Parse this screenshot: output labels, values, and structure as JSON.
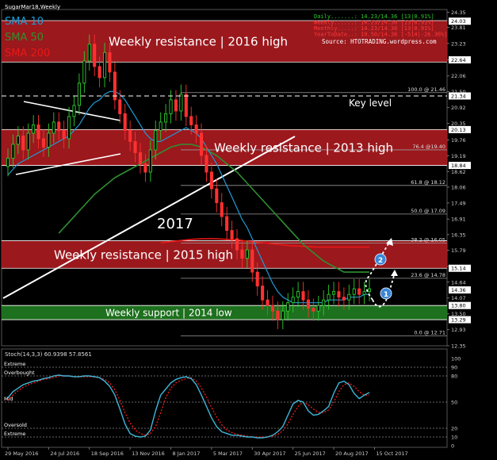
{
  "window": {
    "title": "SugarMar18,Weekly"
  },
  "indicators_legend": [
    {
      "label": "SMA 10",
      "color": "#1e9bd7"
    },
    {
      "label": "SMA 50",
      "color": "#2f8f2f"
    },
    {
      "label": "SMA 200",
      "color": "#e81818"
    }
  ],
  "info_panel": {
    "lines": [
      "Daily.......: 14.23/14.36 [13|0.91%]",
      "Weekly......: 14.23/14.36 [13|0.91%]",
      "Monthly.....: 14.23/14.36 [13|0.91%]",
      "YearToDate..: 19.50/14.36 [-514|-26.36%]"
    ],
    "source": "Source:  HTOTRADING.wordpress.com"
  },
  "zones": [
    {
      "label": "Weekly resistance | 2016 high",
      "lo": 22.56,
      "hi": 24.05,
      "color": "#a81a1f"
    },
    {
      "label": "Weekly resistance | 2013 high",
      "lo": 18.84,
      "hi": 20.13,
      "color": "#a81a1f"
    },
    {
      "label": "Weekly resistance | 2015 high",
      "lo": 15.14,
      "hi": 16.13,
      "color": "#a81a1f"
    },
    {
      "label": "Weekly support | 2014 low",
      "lo": 13.29,
      "hi": 13.8,
      "color": "#1f7a1f"
    }
  ],
  "annotations": {
    "key_level": "Key level",
    "year": "2017",
    "markers": [
      "1",
      "2"
    ]
  },
  "chart_data": {
    "type": "candlestick",
    "price_axis": {
      "ylim": [
        12.35,
        24.45
      ],
      "ticks": [
        "24.35",
        "23.81",
        "23.23",
        "22.64",
        "22.06",
        "21.50",
        "20.92",
        "20.35",
        "19.76",
        "19.19",
        "18.62",
        "18.06",
        "17.49",
        "16.91",
        "16.35",
        "15.79",
        "15.21",
        "14.64",
        "14.07",
        "13.50",
        "12.93",
        "12.35"
      ],
      "highlighted": [
        {
          "label": "24.03",
          "value": 24.03,
          "bg": "#ffffff",
          "fg": "#000000"
        },
        {
          "label": "22.64",
          "value": 22.64,
          "bg": "#ffffff",
          "fg": "#000000"
        },
        {
          "label": "21.34",
          "value": 21.34,
          "bg": "#ffffff",
          "fg": "#000000"
        },
        {
          "label": "20.13",
          "value": 20.13,
          "bg": "#ffffff",
          "fg": "#000000"
        },
        {
          "label": "18.84",
          "value": 18.84,
          "bg": "#ffffff",
          "fg": "#000000"
        },
        {
          "label": "15.14",
          "value": 15.14,
          "bg": "#ffffff",
          "fg": "#000000"
        },
        {
          "label": "14.36",
          "value": 14.36,
          "bg": "#ffffff",
          "fg": "#000000"
        },
        {
          "label": "13.80",
          "value": 13.8,
          "bg": "#ffffff",
          "fg": "#000000"
        },
        {
          "label": "13.29",
          "value": 13.29,
          "bg": "#ffffff",
          "fg": "#000000"
        }
      ]
    },
    "x_axis": {
      "labels": [
        "29 May 2016",
        "24 Jul 2016",
        "18 Sep 2016",
        "13 Nov 2016",
        "8 Jan 2017",
        "5 Mar 2017",
        "30 Apr 2017",
        "25 Jun 2017",
        "20 Aug 2017",
        "15 Oct 2017"
      ],
      "label_index": [
        0,
        8,
        16,
        24,
        32,
        40,
        48,
        56,
        64,
        72
      ]
    },
    "fibonacci": [
      {
        "label": "100.0 @ 21.46",
        "value": 21.46
      },
      {
        "label": "76.4 @19.40",
        "value": 19.4
      },
      {
        "label": "61.8 @ 18.12",
        "value": 18.12
      },
      {
        "label": "50.0 @ 17.09",
        "value": 17.09
      },
      {
        "label": "38.2 @ 16.05",
        "value": 16.05
      },
      {
        "label": "23.6 @ 14.78",
        "value": 14.78
      },
      {
        "label": "0.0 @ 12.71",
        "value": 12.71
      }
    ],
    "key_level_value": 21.34,
    "closes": [
      19.1,
      19.6,
      19.9,
      19.4,
      20.0,
      20.3,
      19.8,
      19.5,
      20.0,
      20.4,
      20.1,
      19.8,
      20.6,
      21.0,
      21.8,
      22.6,
      23.2,
      22.4,
      22.0,
      22.9,
      22.2,
      21.2,
      20.7,
      20.1,
      19.7,
      19.3,
      18.9,
      18.6,
      19.4,
      20.1,
      20.4,
      20.7,
      21.2,
      20.8,
      21.4,
      20.6,
      20.3,
      20.0,
      19.2,
      18.6,
      18.0,
      17.5,
      17.0,
      16.5,
      16.2,
      15.8,
      15.5,
      15.8,
      15.0,
      14.5,
      14.0,
      13.8,
      13.6,
      13.3,
      13.6,
      13.9,
      14.1,
      14.3,
      14.0,
      13.7,
      13.6,
      13.8,
      14.0,
      14.2,
      14.3,
      14.1,
      14.0,
      14.2,
      14.4,
      14.2,
      14.3,
      14.4
    ],
    "opens": [
      18.8,
      19.1,
      19.6,
      19.9,
      19.4,
      20.0,
      20.3,
      19.8,
      19.5,
      20.0,
      20.4,
      20.1,
      19.8,
      20.6,
      21.0,
      21.8,
      22.6,
      23.2,
      22.4,
      22.0,
      22.9,
      22.2,
      21.2,
      20.7,
      20.1,
      19.7,
      19.3,
      18.9,
      18.6,
      19.4,
      20.1,
      20.4,
      20.7,
      21.2,
      20.8,
      21.4,
      20.6,
      20.3,
      20.0,
      19.2,
      18.6,
      18.0,
      17.5,
      17.0,
      16.5,
      16.2,
      15.8,
      15.5,
      15.8,
      15.0,
      14.5,
      14.0,
      13.8,
      13.6,
      13.3,
      13.6,
      13.9,
      14.1,
      14.3,
      14.0,
      13.7,
      13.6,
      13.8,
      14.0,
      14.2,
      14.3,
      14.1,
      14.0,
      14.2,
      14.4,
      14.2,
      14.3
    ],
    "sma10": [
      18.5,
      18.7,
      18.9,
      19.0,
      19.1,
      19.2,
      19.3,
      19.4,
      19.5,
      19.6,
      19.7,
      19.8,
      19.9,
      20.1,
      20.3,
      20.6,
      20.9,
      21.1,
      21.2,
      21.4,
      21.5,
      21.5,
      21.4,
      21.2,
      20.9,
      20.6,
      20.3,
      20.0,
      19.8,
      19.7,
      19.7,
      19.8,
      19.9,
      20.0,
      20.1,
      20.2,
      20.1,
      20.0,
      19.8,
      19.5,
      19.2,
      18.9,
      18.5,
      18.1,
      17.7,
      17.3,
      16.9,
      16.6,
      16.2,
      15.8,
      15.4,
      15.0,
      14.6,
      14.3,
      14.1,
      14.0,
      13.9,
      13.9,
      13.9,
      13.9,
      13.9,
      13.9,
      13.9,
      14.0,
      14.0,
      14.0,
      14.0,
      14.1,
      14.1,
      14.1,
      14.2,
      14.2
    ],
    "sma50": [
      null,
      null,
      null,
      null,
      null,
      null,
      null,
      null,
      null,
      null,
      16.4,
      16.6,
      16.8,
      17.0,
      17.2,
      17.4,
      17.6,
      17.8,
      17.95,
      18.1,
      18.25,
      18.4,
      18.5,
      18.6,
      18.7,
      18.8,
      18.9,
      19.0,
      19.1,
      19.2,
      19.3,
      19.4,
      19.5,
      19.55,
      19.6,
      19.6,
      19.6,
      19.55,
      19.5,
      19.4,
      19.3,
      19.2,
      19.05,
      18.9,
      18.75,
      18.6,
      18.4,
      18.2,
      18.0,
      17.8,
      17.6,
      17.4,
      17.2,
      17.0,
      16.8,
      16.6,
      16.4,
      16.2,
      16.0,
      15.85,
      15.7,
      15.55,
      15.4,
      15.3,
      15.2,
      15.1,
      15.0,
      15.0,
      15.0,
      15.0,
      15.0,
      15.0
    ],
    "sma200": [
      null,
      null,
      null,
      null,
      null,
      null,
      null,
      null,
      null,
      null,
      null,
      null,
      null,
      null,
      null,
      null,
      null,
      null,
      null,
      null,
      null,
      null,
      null,
      null,
      null,
      null,
      null,
      null,
      null,
      null,
      16.05,
      16.08,
      16.1,
      16.12,
      16.14,
      16.16,
      16.18,
      16.19,
      16.2,
      16.2,
      16.2,
      16.2,
      16.19,
      16.18,
      16.17,
      16.16,
      16.14,
      16.12,
      16.1,
      16.08,
      16.06,
      16.04,
      16.02,
      16.0,
      15.98,
      15.96,
      15.95,
      15.94,
      15.93,
      15.92,
      15.91,
      15.9,
      15.9,
      15.9,
      15.9,
      15.9,
      15.9,
      15.9,
      15.9,
      15.9,
      15.9,
      15.9
    ],
    "stochastic": {
      "title": "Stoch(14,3,3) 60.9398 57.8561",
      "ylim": [
        0,
        100
      ],
      "ticks": [
        100,
        90,
        80,
        50,
        20,
        10,
        0
      ],
      "levels": [
        {
          "label": "Extreme",
          "value": 90
        },
        {
          "label": "Overbought",
          "value": 80
        },
        {
          "label": "Mid",
          "value": 50
        },
        {
          "label": "Oversold",
          "value": 20
        },
        {
          "label": "Extreme",
          "value": 10
        }
      ],
      "main": [
        55,
        62,
        66,
        70,
        72,
        74,
        75,
        77,
        78,
        80,
        81,
        80,
        80,
        79,
        79,
        80,
        80,
        79,
        78,
        74,
        68,
        58,
        42,
        25,
        14,
        11,
        10,
        11,
        18,
        40,
        58,
        65,
        72,
        76,
        78,
        79,
        77,
        70,
        58,
        45,
        32,
        22,
        16,
        14,
        12,
        12,
        11,
        10,
        10,
        9,
        9,
        10,
        12,
        16,
        22,
        35,
        48,
        52,
        50,
        40,
        35,
        36,
        40,
        45,
        60,
        72,
        74,
        70,
        60,
        54,
        58,
        61
      ],
      "signal": [
        52,
        58,
        63,
        67,
        70,
        72,
        74,
        76,
        77,
        78,
        80,
        80,
        80,
        79,
        79,
        79,
        79,
        79,
        78,
        76,
        72,
        64,
        52,
        38,
        26,
        18,
        14,
        12,
        14,
        22,
        38,
        55,
        66,
        72,
        75,
        77,
        78,
        74,
        66,
        56,
        44,
        33,
        24,
        18,
        15,
        13,
        12,
        11,
        10,
        10,
        10,
        10,
        11,
        13,
        17,
        25,
        36,
        45,
        50,
        47,
        42,
        38,
        38,
        41,
        50,
        62,
        70,
        72,
        68,
        62,
        58,
        58
      ]
    }
  }
}
